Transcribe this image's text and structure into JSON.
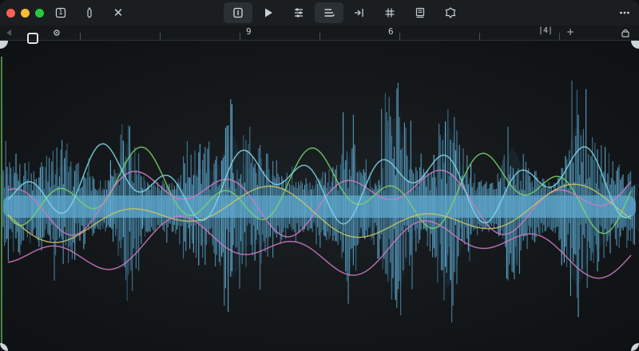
{
  "titlebar": {
    "page_indicator": "1",
    "close_glyph": "✕"
  },
  "toolbar": {
    "tools": [
      {
        "name": "panel-icon",
        "active": true
      },
      {
        "name": "play-icon",
        "active": false
      },
      {
        "name": "mixer-icon",
        "active": false
      },
      {
        "name": "list-icon",
        "active": true
      },
      {
        "name": "split-icon",
        "active": false
      },
      {
        "name": "grid-icon",
        "active": false
      },
      {
        "name": "document-icon",
        "active": false
      },
      {
        "name": "settings-icon",
        "active": false
      }
    ]
  },
  "ruler": {
    "marker_a": "9",
    "marker_b": "6",
    "loop_label": "|4|",
    "add_label": "+"
  },
  "colors": {
    "waveform": "#5fa9cf",
    "waveform_dark": "#3f7f9e",
    "accent_green": "#7bd36a",
    "accent_pink": "#d07ac2",
    "accent_yellow": "#c9c36a",
    "accent_cyan": "#7fd9e6"
  }
}
